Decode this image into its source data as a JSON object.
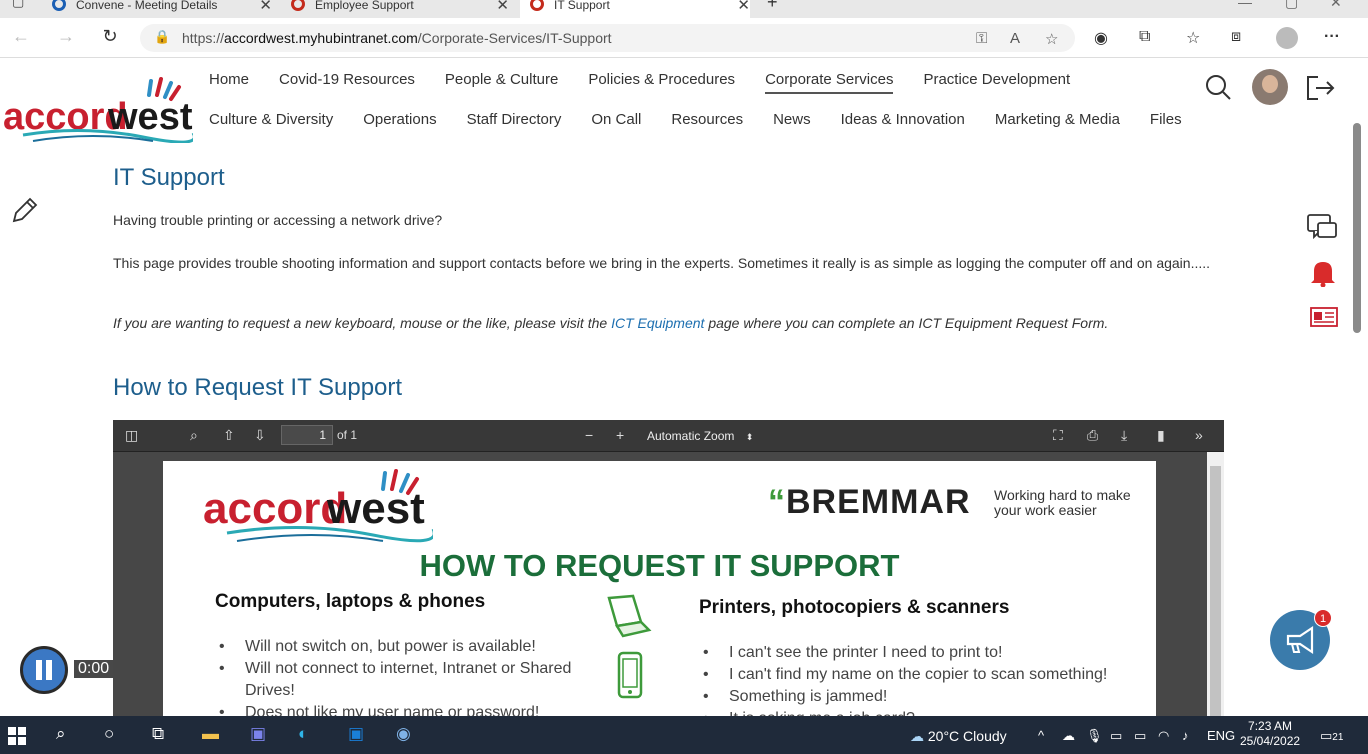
{
  "browser": {
    "tabs": [
      {
        "label": "Convene - Meeting Details"
      },
      {
        "label": "Employee Support"
      },
      {
        "label": "IT Support"
      }
    ],
    "url_prefix": "https://",
    "url_domain": "accordwest.myhubintranet.com",
    "url_path": "/Corporate-Services/IT-Support"
  },
  "site": {
    "logo_accord": "accord",
    "logo_west": "west",
    "nav_row1": [
      "Home",
      "Covid-19 Resources",
      "People & Culture",
      "Policies & Procedures",
      "Corporate Services",
      "Practice Development"
    ],
    "nav_row2": [
      "Culture & Diversity",
      "Operations",
      "Staff Directory",
      "On Call",
      "Resources",
      "News",
      "Ideas & Innovation",
      "Marketing & Media",
      "Files"
    ],
    "active_nav": "Corporate Services"
  },
  "content": {
    "title": "IT Support",
    "p1": "Having trouble printing or accessing a network drive?",
    "p2": "This page provides trouble shooting information and support contacts before we bring in the experts. Sometimes it really is as simple as logging the computer off and on again.....",
    "p3_before": "If you are wanting to request a new keyboard, mouse or the like, please visit the ",
    "p3_link": "ICT Equipment",
    "p3_after": " page where you can complete an ICT Equipment Request Form.",
    "h2": "How to Request IT Support"
  },
  "pdf": {
    "page_value": "1",
    "page_of": "of 1",
    "zoom": "Automatic Zoom",
    "doc": {
      "bremmar": "BREMMAR",
      "tagline": "Working hard to make your work easier",
      "title": "HOW TO REQUEST IT SUPPORT",
      "left_heading": "Computers, laptops & phones",
      "left_items": [
        "Will not switch on, but power is available!",
        "Will not connect to internet, Intranet or Shared Drives!",
        "Does not like my user name or password!"
      ],
      "right_heading": "Printers, photocopiers & scanners",
      "right_items": [
        "I can't see the printer I need to print to!",
        "I can't find my name on the copier to scan something!",
        "Something is jammed!",
        "It is asking me a job card?"
      ]
    }
  },
  "widgets": {
    "announce_badge": "1",
    "player_time": "0:00"
  },
  "taskbar": {
    "weather": "20°C  Cloudy",
    "lang": "ENG",
    "time": "7:23 AM",
    "date": "25/04/2022",
    "notifications": "21"
  }
}
